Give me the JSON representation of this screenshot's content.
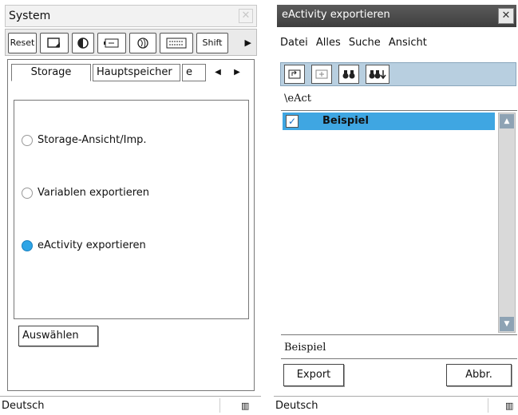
{
  "left": {
    "title": "System",
    "close_glyph": "✕",
    "toolbar": {
      "reset_label": "Reset",
      "shift_label": "Shift",
      "icons": [
        "memo-icon",
        "contrast-icon",
        "battery-icon",
        "globe-icon",
        "keyboard-icon"
      ],
      "more_glyph": "▶"
    },
    "tabs": [
      {
        "label": "Storage",
        "active": true
      },
      {
        "label": "Hauptspeicher",
        "active": false
      },
      {
        "label": "e",
        "active": false
      }
    ],
    "tab_prev_glyph": "◀",
    "tab_next_glyph": "▶",
    "options": [
      {
        "label": "Storage-Ansicht/Imp.",
        "checked": false
      },
      {
        "label": "Variablen exportieren",
        "checked": false
      },
      {
        "label": "eActivity exportieren",
        "checked": true
      }
    ],
    "select_button": "Auswählen",
    "status": {
      "language": "Deutsch",
      "battery_glyph": "▥"
    }
  },
  "right": {
    "title": "eActivity exportieren",
    "close_glyph": "✕",
    "menu": [
      "Datei",
      "Alles",
      "Suche",
      "Ansicht"
    ],
    "toolbar_icons": [
      "folder-up-icon",
      "new-folder-icon",
      "binoculars-icon",
      "binoculars-down-icon"
    ],
    "path": "\\eAct",
    "items": [
      {
        "label": "Beispiel",
        "checked": true
      }
    ],
    "checkmark": "✓",
    "scroll_up_glyph": "▲",
    "scroll_down_glyph": "▼",
    "name_value": "Beispiel",
    "export_label": "Export",
    "cancel_label": "Abbr.",
    "status": {
      "language": "Deutsch",
      "battery_glyph": "▥"
    }
  },
  "colors": {
    "accent": "#3fa6e2",
    "toolbar_blue": "#b8cfe0",
    "titlebar_dark": "#4a4a4a"
  }
}
